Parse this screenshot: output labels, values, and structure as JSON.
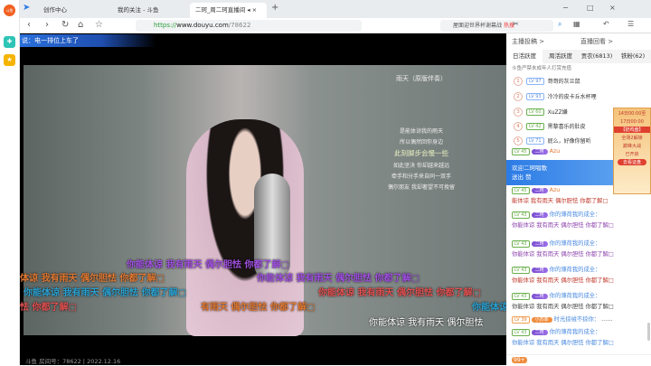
{
  "browser": {
    "tabs": [
      {
        "label": "创作中心"
      },
      {
        "label": "我的关注 - 斗鱼"
      },
      {
        "label": "二珂_周二珂直播间"
      }
    ],
    "new_tab": "+",
    "url_scheme": "https://",
    "url_host": "www.douyu.com",
    "url_path": "/78622",
    "search_text": "屋面迎世界杯谢幕战",
    "search_hot": "热搜",
    "window_controls": [
      "−",
      "□",
      "×"
    ]
  },
  "leftbar": {
    "logo": "斗鱼"
  },
  "video": {
    "banner": "说：电一排位上车了",
    "song_title": "雨天（原版伴奏）",
    "lyrics": [
      "是能体谅我的雨天",
      "所以偶然回你身边",
      "此刻脚步会慢一些",
      "如此坚决 你却越来越远",
      "牵手和分手来自同一双手",
      "偶尔朋友 我却奢望不可挽留"
    ],
    "danmaku": [
      {
        "text": "你能体谅 我有雨天 偶尔胆怯 你都了解□",
        "color": "#a050e0"
      },
      {
        "text": "体谅 我有雨天 偶尔胆怯 你都了解□",
        "color": "#e07830"
      },
      {
        "text": "你能体谅 我有雨天 偶尔胆怯 你都了解□",
        "color": "#a050e0"
      },
      {
        "text": "你能体谅 我有雨天 偶尔胆怯 你都了解□",
        "color": "#2aa0d0"
      },
      {
        "text": "你能体谅 我有雨天 偶尔胆怯 你都了解□",
        "color": "#e05050"
      },
      {
        "text": "怯 你都了解□",
        "color": "#e05050"
      },
      {
        "text": "有雨天 偶尔胆怯 你都了解□",
        "color": "#e07830"
      },
      {
        "text": "你能体谅",
        "color": "#2aa0d0"
      },
      {
        "text": "你能体谅 我有雨天 偶尔胆怯",
        "color": "#ffffff"
      }
    ],
    "room_info": "斗鱼 房间号：78622 | 2022.12.16"
  },
  "right": {
    "header_left": "主播投稿 >",
    "header_right": "直播回看 >",
    "tabs": [
      "日活跃度",
      "周活跃度",
      "贡农(6813)",
      "铁粉(62)"
    ],
    "notice": "斗鱼严禁未成年人打赏充值",
    "ranks": [
      {
        "num": "1",
        "level": "LV 97",
        "name": "哥哥的灰兰鼠"
      },
      {
        "num": "2",
        "level": "LV 93",
        "name": "冷冷的皮卡丘水杯哩"
      },
      {
        "num": "3",
        "level": "LV 60",
        "name": "XuZZ嫌"
      },
      {
        "num": "4",
        "level": "LV 42",
        "name": "黑黎喜乐的肚皮"
      },
      {
        "num": "5",
        "level": "LV 71",
        "name": "屁么，好像你留听"
      }
    ],
    "welcome_title": "欢迎二珂唱歌",
    "welcome_sub": "送出 赞",
    "promo": [
      "14日00:00至",
      "17日00:00",
      "【奶鸡盘】",
      "全场2解锁",
      "巅峰大战",
      "已开启",
      "去看证盘"
    ],
    "chat": [
      {
        "level": "LV 45",
        "fan": "二珂",
        "user": "Azu",
        "msg": ""
      },
      {
        "level": "LV 45",
        "fan": "二珂",
        "user": "Azu",
        "msg": "能体谅 我有雨天 偶尔胆怯 你都了解□"
      },
      {
        "level": "LV 43",
        "fan": "二珂",
        "user": "你的薄荷我的成全：",
        "msg": "你能体谅 我有雨天 偶尔胆怯 你都了解□"
      },
      {
        "level": "LV 43",
        "fan": "二珂",
        "user": "你的薄荷我的成全：",
        "msg": "你能体谅 我有雨天 偶尔胆怯 你都了解□"
      },
      {
        "level": "LV 43",
        "fan": "二珂",
        "user": "你的薄荷我的成全：",
        "msg": "你能体谅 我有雨天 偶尔胆怯 你都了解□"
      },
      {
        "level": "LV 43",
        "fan": "二珂",
        "user": "你的薄荷我的成全：",
        "msg": "你能体谅 我有雨天 偶尔胆怯 你都了解□"
      },
      {
        "level": "LV 39",
        "fan": "小苏菲",
        "user": "时光掠绒不掠你：",
        "msg": "……"
      },
      {
        "level": "LV 43",
        "fan": "二珂",
        "user": "你的薄荷我的成全：",
        "msg": "你能体谅 我有雨天 偶尔胆怯 你都了解□"
      }
    ],
    "bottom_count": "99+"
  },
  "colors": {
    "brand": "#ff6a00",
    "accent": "#2c7be5"
  }
}
